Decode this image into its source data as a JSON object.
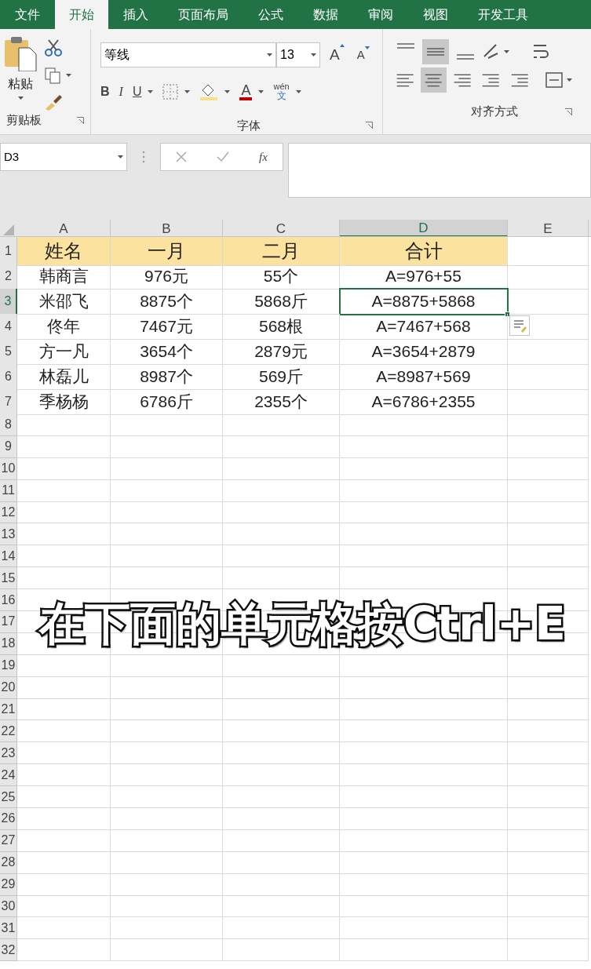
{
  "tabs": [
    {
      "label": "文件",
      "selected": false
    },
    {
      "label": "开始",
      "selected": true
    },
    {
      "label": "插入",
      "selected": false
    },
    {
      "label": "页面布局",
      "selected": false
    },
    {
      "label": "公式",
      "selected": false
    },
    {
      "label": "数据",
      "selected": false
    },
    {
      "label": "审阅",
      "selected": false
    },
    {
      "label": "视图",
      "selected": false
    },
    {
      "label": "开发工具",
      "selected": false
    }
  ],
  "ribbon": {
    "clipboard": {
      "paste": "粘贴",
      "label": "剪贴板"
    },
    "font": {
      "font_name": "等线",
      "font_size": "13",
      "grow": "A",
      "shrink": "A",
      "bold": "B",
      "italic": "I",
      "underline": "U",
      "font_color": "A",
      "phonetic_top": "wén",
      "phonetic_bottom": "文",
      "label": "字体"
    },
    "alignment": {
      "label": "对齐方式"
    }
  },
  "name_box": "D3",
  "fx": "fx",
  "columns": [
    {
      "label": "A",
      "selected": false
    },
    {
      "label": "B",
      "selected": false
    },
    {
      "label": "C",
      "selected": false
    },
    {
      "label": "D",
      "selected": true
    },
    {
      "label": "E",
      "selected": false
    }
  ],
  "rows": [
    {
      "number": "1",
      "kind": "header",
      "selected": false,
      "cells": [
        "姓名",
        "一月",
        "二月",
        "合计"
      ]
    },
    {
      "number": "2",
      "kind": "data",
      "selected": false,
      "cells": [
        "韩商言",
        "976元",
        "55个",
        "A=976+55"
      ]
    },
    {
      "number": "3",
      "kind": "data",
      "selected": true,
      "cells": [
        "米邵飞",
        "8875个",
        "5868斤",
        "A=8875+5868"
      ]
    },
    {
      "number": "4",
      "kind": "data",
      "selected": false,
      "cells": [
        "佟年",
        "7467元",
        "568根",
        "A=7467+568"
      ]
    },
    {
      "number": "5",
      "kind": "data",
      "selected": false,
      "cells": [
        "方一凡",
        "3654个",
        "2879元",
        "A=3654+2879"
      ]
    },
    {
      "number": "6",
      "kind": "data",
      "selected": false,
      "cells": [
        "林磊儿",
        "8987个",
        "569斤",
        "A=8987+569"
      ]
    },
    {
      "number": "7",
      "kind": "data",
      "selected": false,
      "cells": [
        "季杨杨",
        "6786斤",
        "2355个",
        "A=6786+2355"
      ]
    },
    {
      "number": "8",
      "kind": "empty",
      "selected": false
    },
    {
      "number": "9",
      "kind": "empty",
      "selected": false
    },
    {
      "number": "10",
      "kind": "empty",
      "selected": false
    },
    {
      "number": "11",
      "kind": "empty",
      "selected": false
    },
    {
      "number": "12",
      "kind": "empty",
      "selected": false
    },
    {
      "number": "13",
      "kind": "empty",
      "selected": false
    },
    {
      "number": "14",
      "kind": "empty",
      "selected": false
    },
    {
      "number": "15",
      "kind": "empty",
      "selected": false
    },
    {
      "number": "16",
      "kind": "empty",
      "selected": false
    },
    {
      "number": "17",
      "kind": "empty",
      "selected": false
    },
    {
      "number": "18",
      "kind": "empty",
      "selected": false
    },
    {
      "number": "19",
      "kind": "empty",
      "selected": false
    },
    {
      "number": "20",
      "kind": "empty",
      "selected": false
    },
    {
      "number": "21",
      "kind": "empty",
      "selected": false
    },
    {
      "number": "22",
      "kind": "empty",
      "selected": false
    },
    {
      "number": "23",
      "kind": "empty",
      "selected": false
    },
    {
      "number": "24",
      "kind": "empty",
      "selected": false
    },
    {
      "number": "25",
      "kind": "empty",
      "selected": false
    },
    {
      "number": "26",
      "kind": "empty",
      "selected": false
    },
    {
      "number": "27",
      "kind": "empty",
      "selected": false
    },
    {
      "number": "28",
      "kind": "empty",
      "selected": false
    },
    {
      "number": "29",
      "kind": "empty",
      "selected": false
    },
    {
      "number": "30",
      "kind": "empty",
      "selected": false
    },
    {
      "number": "31",
      "kind": "empty",
      "selected": false
    },
    {
      "number": "32",
      "kind": "empty",
      "selected": false
    }
  ],
  "caption": "在下面的单元格按Ctrl+E"
}
